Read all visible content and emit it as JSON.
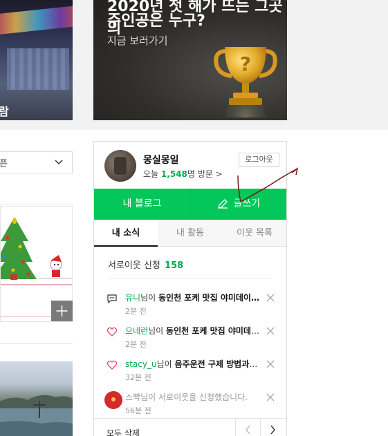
{
  "banners": {
    "left_caption": "람",
    "right_title_line1": "2020년 첫 해가 뜨는 그곳의",
    "right_title_line2": "주인공은 누구?",
    "right_subtitle": "지금 보러가기"
  },
  "left_column": {
    "select_value": "픈"
  },
  "profile": {
    "nickname": "몽실몽일",
    "visits_prefix": "오늘",
    "visits_count": "1,548",
    "visits_suffix": "명 방문 >",
    "logout_label": "로그아웃",
    "my_blog_label": "내 블로그",
    "write_label": "글쓰기"
  },
  "tabs": [
    {
      "label": "내 소식"
    },
    {
      "label": "내 활동"
    },
    {
      "label": "이웃 목록"
    }
  ],
  "neighbor_request": {
    "label": "서로이웃 신청",
    "count": "158"
  },
  "notifications": [
    {
      "icon": "comment-icon",
      "who": "유니",
      "mid": "님이 ",
      "topic": "동인천 포케 맛집 야미데이…",
      "time": "2분 전"
    },
    {
      "icon": "heart-icon",
      "who": "으네런",
      "mid": "님이 ",
      "topic": "동인천 포케 맛집 야미데이…",
      "time": "2분 전"
    },
    {
      "icon": "heart-icon",
      "who": "stacy_u",
      "mid": "님이 ",
      "topic": "음주운전 구제 방법과 …",
      "time": "32분 전"
    },
    {
      "icon": "avatar-icon",
      "who": "스빡",
      "mid": "님이 서로이웃을 신청했습니다.",
      "topic": "",
      "time": "56분 전"
    }
  ],
  "footer": {
    "delete_all_label": "모두 삭제"
  },
  "colors": {
    "accent_green": "#03c75a",
    "text_green": "#03a94d",
    "scribble_red": "#7a1414"
  }
}
